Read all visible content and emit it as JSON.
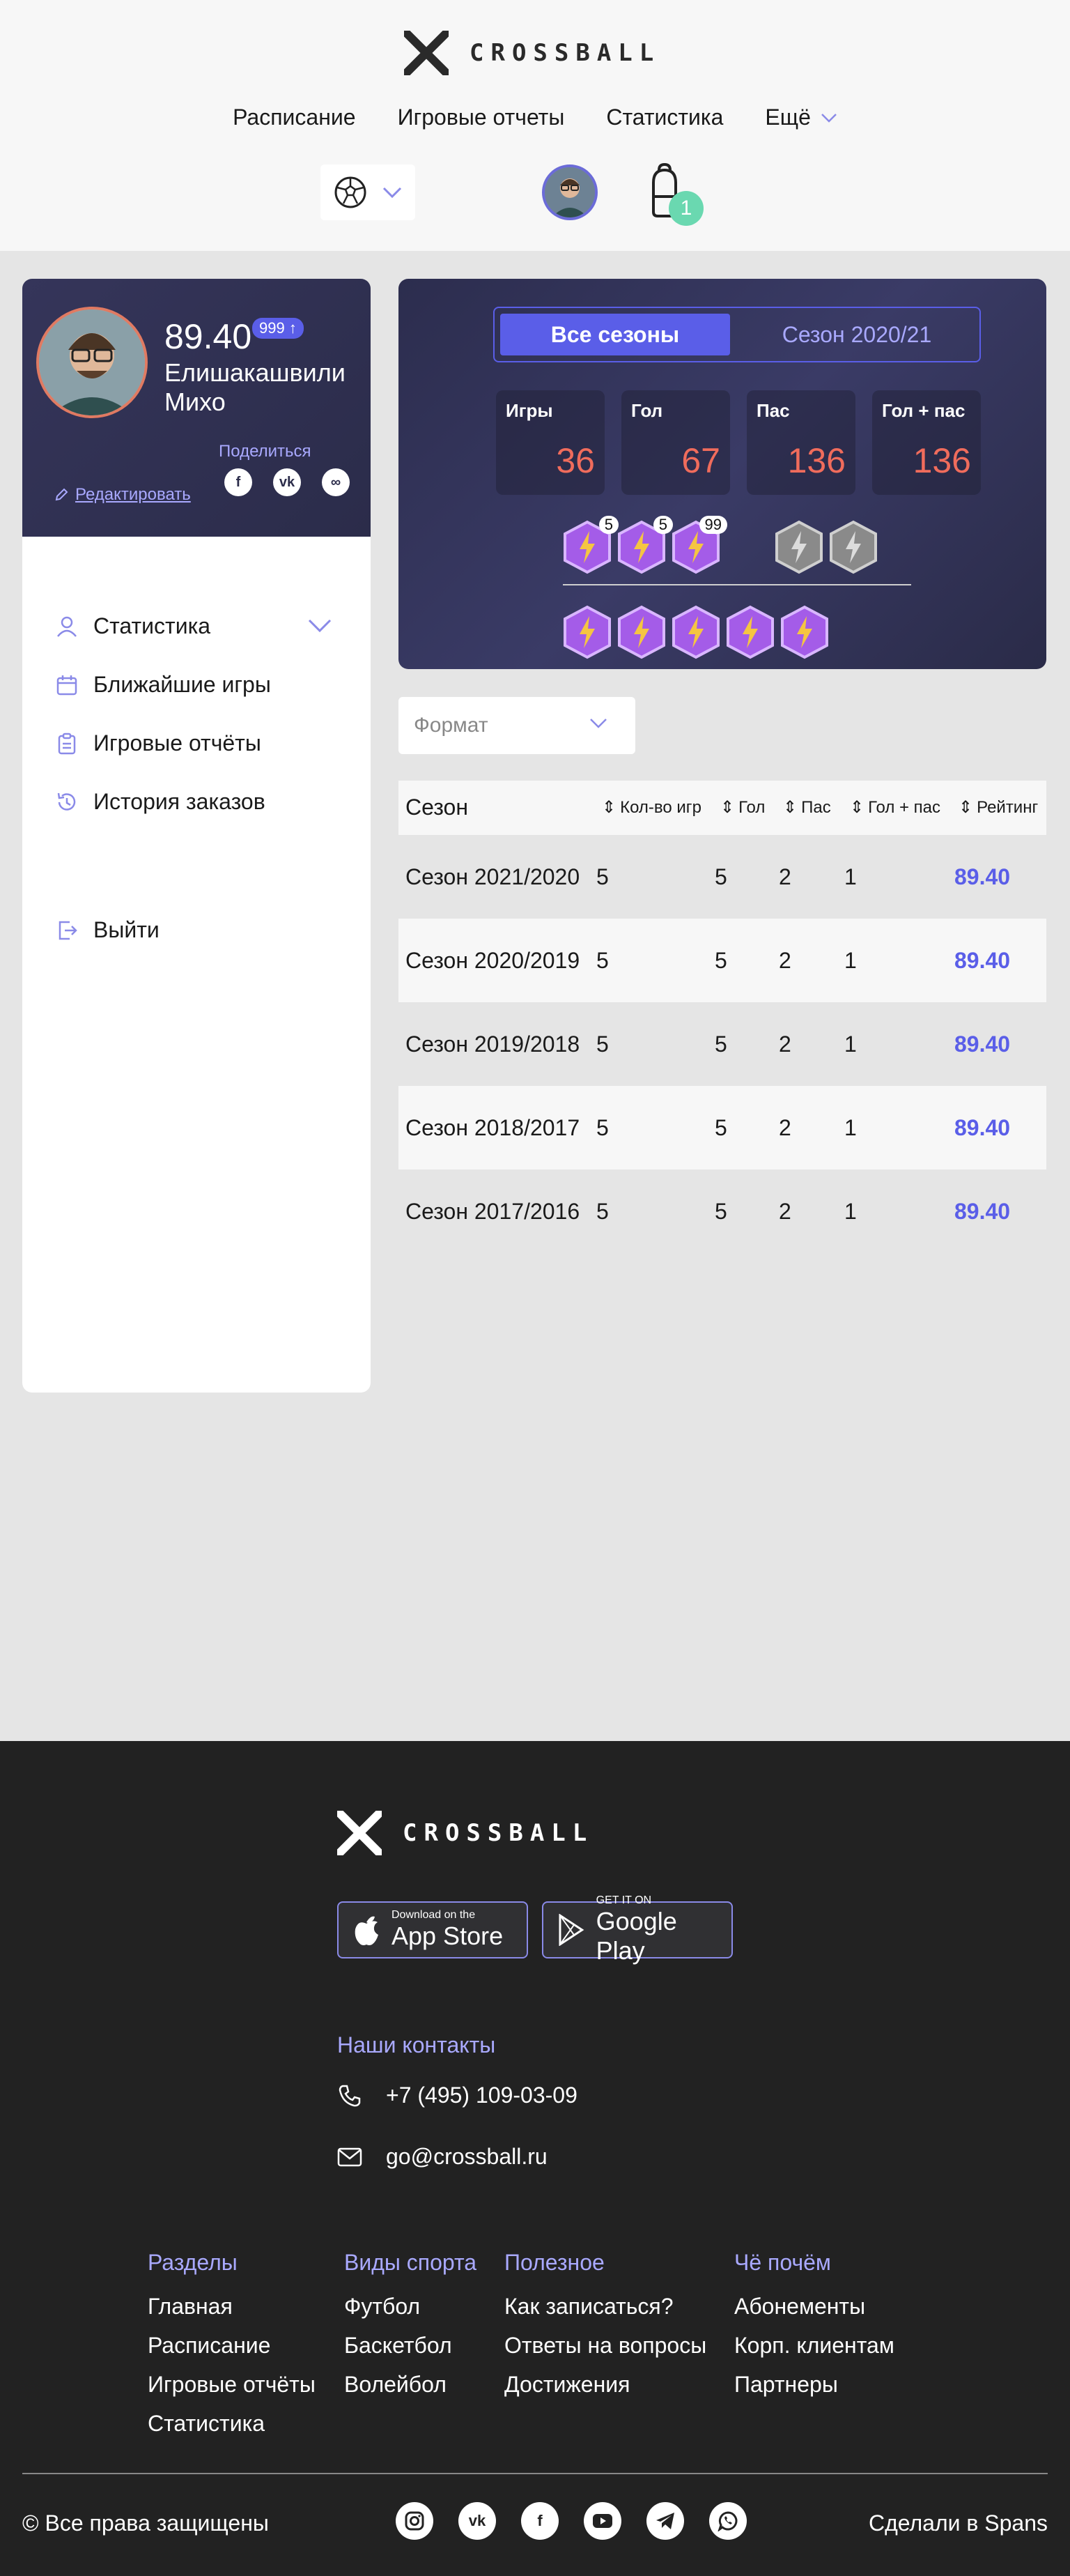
{
  "header": {
    "logo_text": "CROSSBALL",
    "nav": [
      "Расписание",
      "Игровые отчеты",
      "Статистика"
    ],
    "nav_more": "Ещё",
    "cart_count": "1"
  },
  "profile": {
    "rating": "89.40",
    "badge": "999 ↑",
    "name": "Елишакашвили Михо",
    "share_label": "Поделиться",
    "edit_label": "Редактировать",
    "share_icons": [
      "facebook-icon",
      "vk-icon",
      "link-icon"
    ]
  },
  "sidebar": {
    "items": [
      {
        "label": "Статистика",
        "icon": "user-icon"
      },
      {
        "label": "Ближайшие игры",
        "icon": "calendar-icon"
      },
      {
        "label": "Игровые отчёты",
        "icon": "clipboard-icon"
      },
      {
        "label": "История заказов",
        "icon": "history-icon"
      }
    ],
    "logout": "Выйти"
  },
  "stats": {
    "tabs": [
      "Все сезоны",
      "Сезон 2020/21"
    ],
    "boxes": [
      {
        "label": "Игры",
        "value": "36"
      },
      {
        "label": "Гол",
        "value": "67"
      },
      {
        "label": "Пас",
        "value": "136"
      },
      {
        "label": "Гол + пас",
        "value": "136"
      }
    ],
    "badge_counts": [
      "5",
      "5",
      "99"
    ]
  },
  "filter": {
    "placeholder": "Формат"
  },
  "table": {
    "headers": [
      "Сезон",
      "Кол-во игр",
      "Гол",
      "Пас",
      "Гол + пас",
      "Рейтинг"
    ],
    "rows": [
      [
        "Сезон 2021/2020",
        "5",
        "5",
        "2",
        "1",
        "89.40"
      ],
      [
        "Сезон 2020/2019",
        "5",
        "5",
        "2",
        "1",
        "89.40"
      ],
      [
        "Сезон 2019/2018",
        "5",
        "5",
        "2",
        "1",
        "89.40"
      ],
      [
        "Сезон 2018/2017",
        "5",
        "5",
        "2",
        "1",
        "89.40"
      ],
      [
        "Сезон 2017/2016",
        "5",
        "5",
        "2",
        "1",
        "89.40"
      ]
    ]
  },
  "footer": {
    "logo_text": "CROSSBALL",
    "appstore_small": "Download on the",
    "appstore_big": "App Store",
    "gplay_small": "GET IT ON",
    "gplay_big": "Google Play",
    "contacts_title": "Наши контакты",
    "phone": "+7 (495) 109-03-09",
    "email": "go@crossball.ru",
    "columns": [
      {
        "title": "Разделы",
        "links": [
          "Главная",
          "Расписание",
          "Игровые отчёты",
          "Статистика"
        ]
      },
      {
        "title": "Виды спорта",
        "links": [
          "Футбол",
          "Баскетбол",
          "Волейбол"
        ]
      },
      {
        "title": "Полезное",
        "links": [
          "Как записаться?",
          "Ответы на вопросы",
          "Достижения"
        ]
      },
      {
        "title": "Чё почём",
        "links": [
          "Абонементы",
          "Корп. клиентам",
          "Партнеры"
        ]
      }
    ],
    "copyright": "© Все права защищены",
    "made_by": "Сделали в Spans",
    "socials": [
      "instagram-icon",
      "vk-icon",
      "facebook-icon",
      "youtube-icon",
      "telegram-icon",
      "whatsapp-icon"
    ]
  }
}
